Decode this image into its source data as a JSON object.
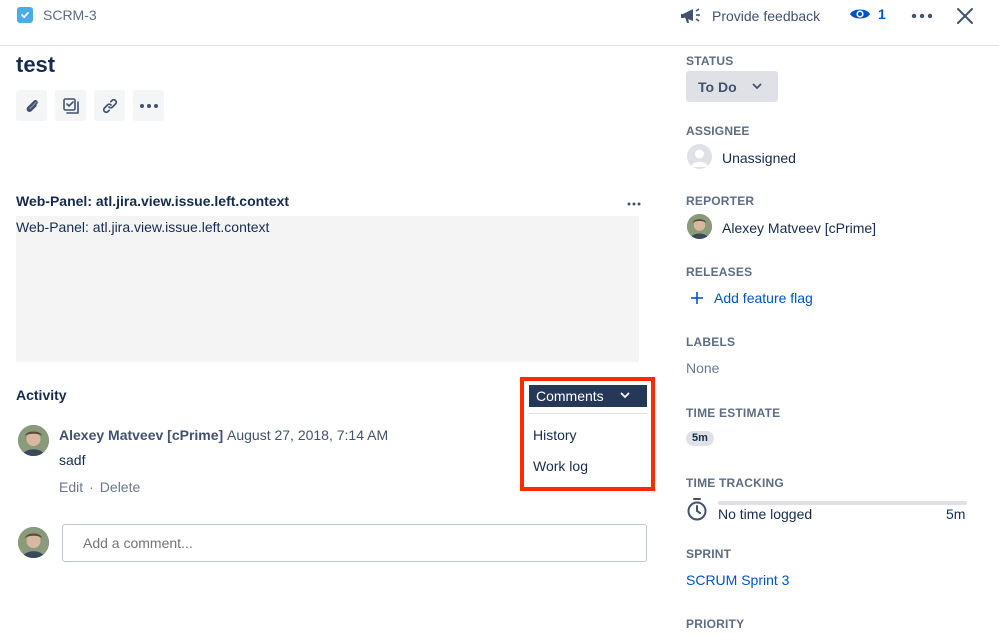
{
  "header": {
    "issue_key": "SCRM-3",
    "feedback_label": "Provide feedback",
    "watch_count": "1"
  },
  "issue": {
    "title": "test"
  },
  "web_panel": {
    "title": "Web-Panel: atl.jira.view.issue.left.context",
    "content": "Web-Panel: atl.jira.view.issue.left.context"
  },
  "activity": {
    "label": "Activity",
    "dropdown": {
      "selected": "Comments",
      "options": [
        "History",
        "Work log"
      ]
    },
    "comment": {
      "author": "Alexey Matveev [cPrime]",
      "date": "August 27, 2018, 7:14 AM",
      "body": "sadf",
      "edit_label": "Edit",
      "separator": "·",
      "delete_label": "Delete"
    },
    "add_comment_placeholder": "Add a comment..."
  },
  "sidebar": {
    "status": {
      "label": "STATUS",
      "value": "To Do"
    },
    "assignee": {
      "label": "ASSIGNEE",
      "value": "Unassigned"
    },
    "reporter": {
      "label": "REPORTER",
      "value": "Alexey Matveev [cPrime]"
    },
    "releases": {
      "label": "RELEASES",
      "action": "Add feature flag"
    },
    "labels": {
      "label": "LABELS",
      "value": "None"
    },
    "time_estimate": {
      "label": "TIME ESTIMATE",
      "value": "5m"
    },
    "time_tracking": {
      "label": "TIME TRACKING",
      "logged": "No time logged",
      "remaining": "5m"
    },
    "sprint": {
      "label": "SPRINT",
      "value": "SCRUM Sprint 3"
    },
    "priority": {
      "label": "PRIORITY"
    }
  },
  "colors": {
    "accent": "#0052cc",
    "highlight_border": "#ff2a00",
    "dropdown_bg": "#253858"
  }
}
